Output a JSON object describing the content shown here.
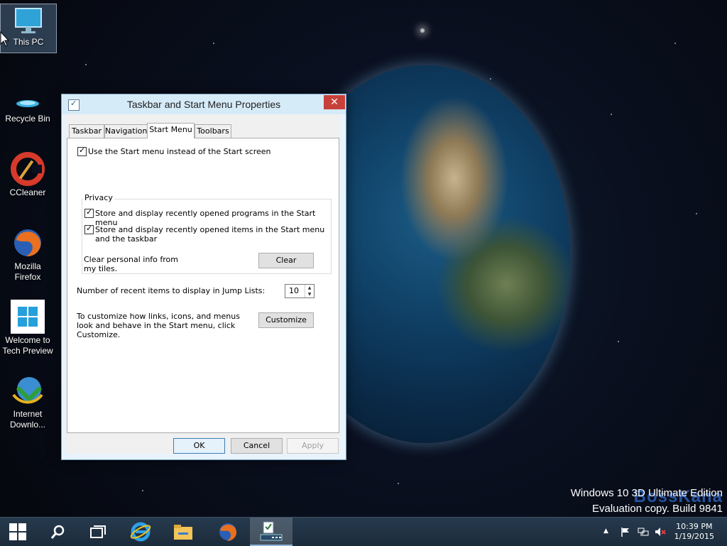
{
  "desktop": {
    "icons": [
      {
        "label": "This PC",
        "icon": "this-pc-icon"
      },
      {
        "label": "Recycle Bin",
        "icon": "recycle-bin-icon"
      },
      {
        "label": "CCleaner",
        "icon": "ccleaner-icon"
      },
      {
        "label": "Mozilla Firefox",
        "icon": "firefox-icon"
      },
      {
        "label": "Welcome to Tech Preview",
        "icon": "windows-logo-icon"
      },
      {
        "label": "Internet Downlo...",
        "icon": "idm-icon"
      }
    ],
    "watermark": {
      "line1": "Windows 10 3D Ultimate Edition",
      "line2": "Evaluation copy. Build 9841",
      "brand": "BossKana"
    }
  },
  "dialog": {
    "title": "Taskbar and Start Menu Properties",
    "close": "✕",
    "tabs": [
      "Taskbar",
      "Navigation",
      "Start Menu",
      "Toolbars"
    ],
    "active_tab": "Start Menu",
    "use_start_menu": {
      "label": "Use the Start menu instead of the Start screen",
      "checked": true
    },
    "privacy": {
      "title": "Privacy",
      "recent_programs": {
        "label": "Store and display recently opened programs in the Start menu",
        "checked": true
      },
      "recent_items": {
        "label": "Store and display recently opened items in the Start menu and the taskbar",
        "checked": true
      },
      "clear_text": "Clear personal info from my tiles.",
      "clear_button": "Clear"
    },
    "jump_lists": {
      "label": "Number of recent items to display in Jump Lists:",
      "value": "10"
    },
    "customize": {
      "text": "To customize how links, icons, and menus look and behave in the Start menu, click Customize.",
      "button": "Customize"
    },
    "buttons": {
      "ok": "OK",
      "cancel": "Cancel",
      "apply": "Apply"
    }
  },
  "taskbar": {
    "clock": {
      "time": "10:39 PM",
      "date": "1/19/2015"
    },
    "tray_icons": [
      "chevron-up-icon",
      "flag-icon",
      "network-icon",
      "volume-muted-icon"
    ]
  },
  "colors": {
    "accent": "#c7413a",
    "dialog_border": "#7aa7c9",
    "taskbar": "#1c2b3a"
  }
}
